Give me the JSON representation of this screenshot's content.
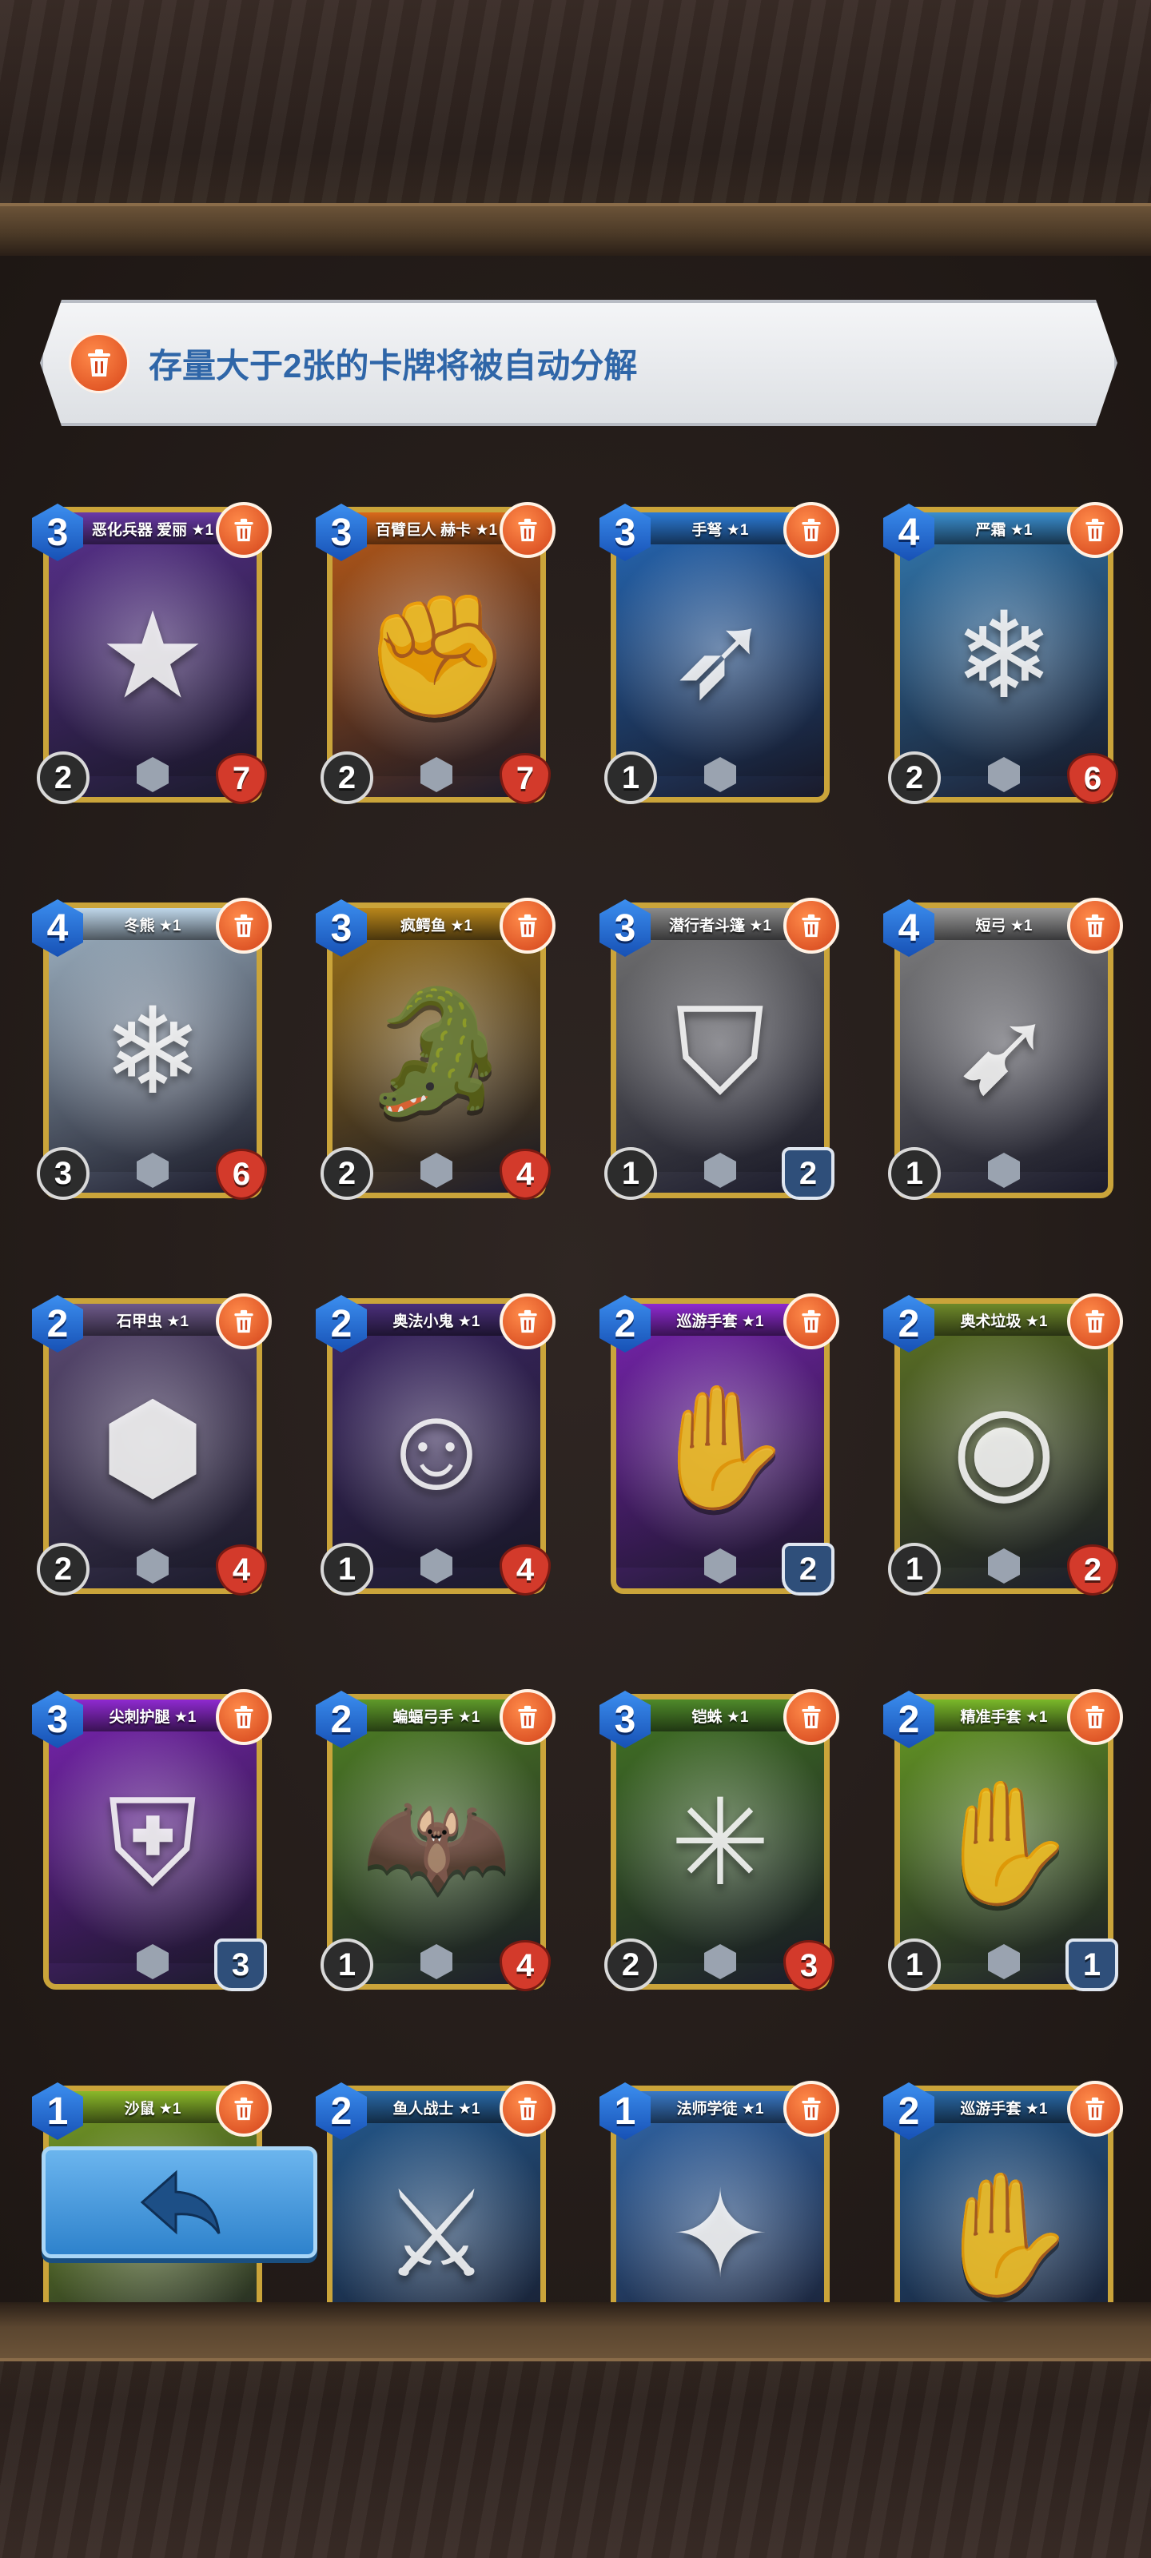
{
  "notice": {
    "text": "存量大于2张的卡牌将被自动分解"
  },
  "cards": [
    {
      "name": "恶化兵器 爱丽 ★1",
      "cost": "3",
      "attack": "2",
      "health": "7",
      "defense": "",
      "color": "#6a3aa8",
      "icon": "★"
    },
    {
      "name": "百臂巨人 赫卡 ★1",
      "cost": "3",
      "attack": "2",
      "health": "7",
      "defense": "",
      "color": "#d96a1c",
      "icon": "✊"
    },
    {
      "name": "手弩 ★1",
      "cost": "3",
      "attack": "1",
      "health": "",
      "defense": "",
      "color": "#2c7bd6",
      "icon": "➶"
    },
    {
      "name": "严霜 ★1",
      "cost": "4",
      "attack": "2",
      "health": "6",
      "defense": "",
      "color": "#3b8fd0",
      "icon": "❄"
    },
    {
      "name": "冬熊 ★1",
      "cost": "4",
      "attack": "3",
      "health": "6",
      "defense": "",
      "color": "#bfd7ea",
      "icon": "❄"
    },
    {
      "name": "疯鳄鱼 ★1",
      "cost": "3",
      "attack": "2",
      "health": "4",
      "defense": "",
      "color": "#b8861b",
      "icon": "🐊"
    },
    {
      "name": "潜行者斗篷 ★1",
      "cost": "3",
      "attack": "1",
      "health": "",
      "defense": "2",
      "color": "#8a8a8a",
      "icon": "⛉"
    },
    {
      "name": "短弓 ★1",
      "cost": "4",
      "attack": "1",
      "health": "",
      "defense": "",
      "color": "#9a9a9a",
      "icon": "➹"
    },
    {
      "name": "石甲虫 ★1",
      "cost": "2",
      "attack": "2",
      "health": "4",
      "defense": "",
      "color": "#6e5a8a",
      "icon": "⬢"
    },
    {
      "name": "奥法小鬼 ★1",
      "cost": "2",
      "attack": "1",
      "health": "4",
      "defense": "",
      "color": "#4a2f7a",
      "icon": "☺"
    },
    {
      "name": "巡游手套 ★1",
      "cost": "2",
      "attack": "",
      "health": "",
      "defense": "2",
      "color": "#8f2ad0",
      "icon": "✋"
    },
    {
      "name": "奥术垃圾 ★1",
      "cost": "2",
      "attack": "1",
      "health": "2",
      "defense": "",
      "color": "#6f8a2a",
      "icon": "◉"
    },
    {
      "name": "尖刺护腿 ★1",
      "cost": "3",
      "attack": "",
      "health": "",
      "defense": "3",
      "color": "#8f2ad0",
      "icon": "⛨"
    },
    {
      "name": "蝙蝠弓手 ★1",
      "cost": "2",
      "attack": "1",
      "health": "4",
      "defense": "",
      "color": "#5f9a2a",
      "icon": "🦇"
    },
    {
      "name": "铠蛛 ★1",
      "cost": "3",
      "attack": "2",
      "health": "3",
      "defense": "",
      "color": "#4f8a2a",
      "icon": "✳"
    },
    {
      "name": "精准手套 ★1",
      "cost": "2",
      "attack": "1",
      "health": "",
      "defense": "1",
      "color": "#7ab82a",
      "icon": "✋"
    },
    {
      "name": "沙鼠 ★1",
      "cost": "1",
      "attack": "",
      "health": "",
      "defense": "",
      "color": "#8ab82a",
      "icon": ""
    },
    {
      "name": "鱼人战士 ★1",
      "cost": "2",
      "attack": "",
      "health": "",
      "defense": "",
      "color": "#2a6aa8",
      "icon": "⚔"
    },
    {
      "name": "法师学徒 ★1",
      "cost": "1",
      "attack": "",
      "health": "",
      "defense": "",
      "color": "#3a7ac8",
      "icon": "✦"
    },
    {
      "name": "巡游手套 ★1",
      "cost": "2",
      "attack": "",
      "health": "",
      "defense": "",
      "color": "#2a6aa8",
      "icon": "✋"
    }
  ],
  "back_button": {
    "icon": "back-arrow-icon"
  }
}
